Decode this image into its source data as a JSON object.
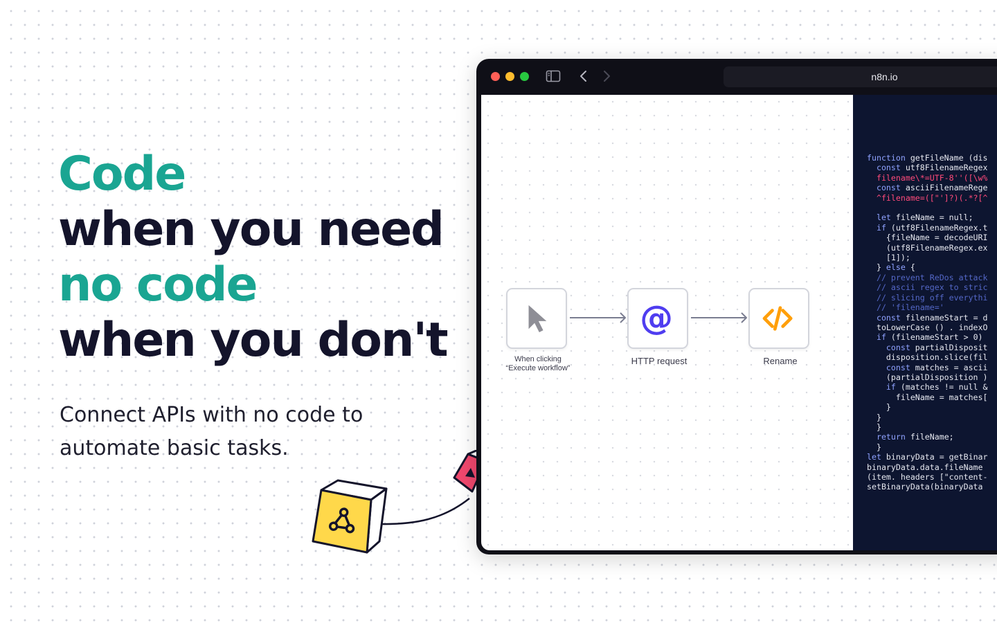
{
  "hero": {
    "line1": "Code",
    "line2": "when you need",
    "line3": "no code",
    "line4": "when you don't",
    "subtitle_line1": "Connect APIs with no code to",
    "subtitle_line2": "automate basic tasks."
  },
  "colors": {
    "accent": "#1aa592",
    "headline": "#14142b",
    "code_bg": "#0d1530",
    "node_at": "#4f3df0",
    "node_code": "#ff9f0a",
    "deco_yellow": "#ffd84a",
    "deco_pink": "#f0486e"
  },
  "browser": {
    "url": "n8n.io"
  },
  "workflow": {
    "nodes": [
      {
        "id": "trigger",
        "label_line1": "When clicking",
        "label_line2": "“Execute workflow”",
        "icon": "cursor-icon"
      },
      {
        "id": "http",
        "label": "HTTP request",
        "icon": "at-sign-icon"
      },
      {
        "id": "rename",
        "label": "Rename",
        "icon": "code-brackets-icon"
      }
    ]
  },
  "code": {
    "lines": [
      "function getFileName (dis",
      "  const utf8FilenameRegex",
      "  filename\\*=UTF-8''([\\w%",
      "  const asciiFilenameRege",
      "  ^filename=([\"']?)(.*?[^",
      "",
      "  let fileName = null;",
      "  if (utf8FilenameRegex.t",
      "    {fileName = decodeURI",
      "    (utf8FilenameRegex.ex",
      "    [1]);",
      "  } else {",
      "  // prevent ReDos attack",
      "  // ascii regex to stric",
      "  // slicing off everythi",
      "  // 'filename='",
      "  const filenameStart = d",
      "  toLowerCase () . indexO",
      "  if (filenameStart > 0)",
      "    const partialDisposit",
      "    disposition.slice(fil",
      "    const matches = ascii",
      "    (partialDisposition )",
      "    if (matches != null &",
      "      fileName = matches[",
      "    }",
      "  }",
      "  }",
      "  return fileName;",
      "  }",
      "let binaryData = getBinar",
      "binaryData.data.fileName",
      "(item. headers [\"content-",
      "setBinaryData(binaryData"
    ]
  },
  "decor": {
    "icons": [
      "webhook-icon",
      "webhook-icon"
    ]
  }
}
